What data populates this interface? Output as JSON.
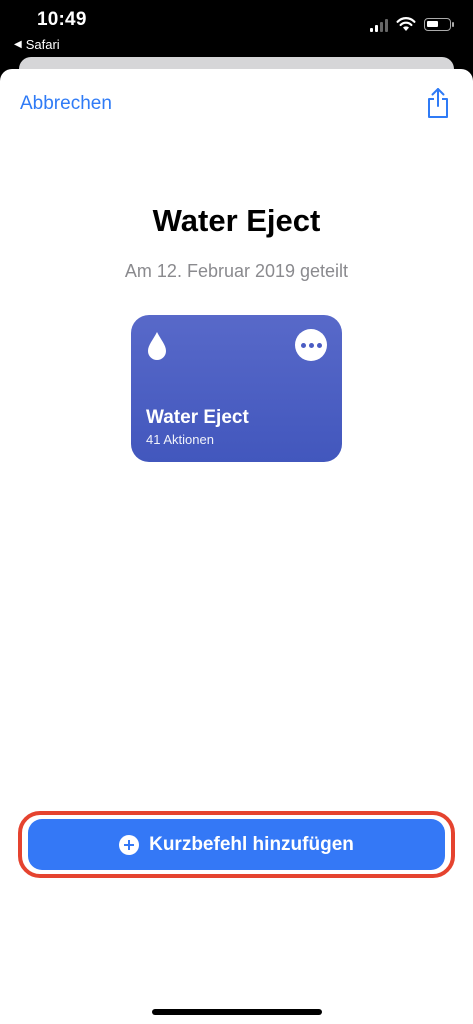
{
  "status_bar": {
    "time": "10:49",
    "back_app": "Safari",
    "icons": [
      "signal-icon",
      "wifi-icon",
      "battery-icon"
    ]
  },
  "header": {
    "cancel_label": "Abbrechen",
    "share_icon": "share-icon"
  },
  "shortcut": {
    "title": "Water Eject",
    "shared_date": "Am 12. Februar 2019 geteilt",
    "card": {
      "name": "Water Eject",
      "actions": "41 Aktionen",
      "icon": "water-drop-icon",
      "more_icon": "more-icon",
      "color_top": "#5869c9",
      "color_bottom": "#4257bd"
    }
  },
  "footer": {
    "add_label": "Kurzbefehl hinzufügen",
    "add_icon": "plus-circle-icon",
    "button_color": "#3478f6",
    "highlight_color": "#e5432f"
  }
}
